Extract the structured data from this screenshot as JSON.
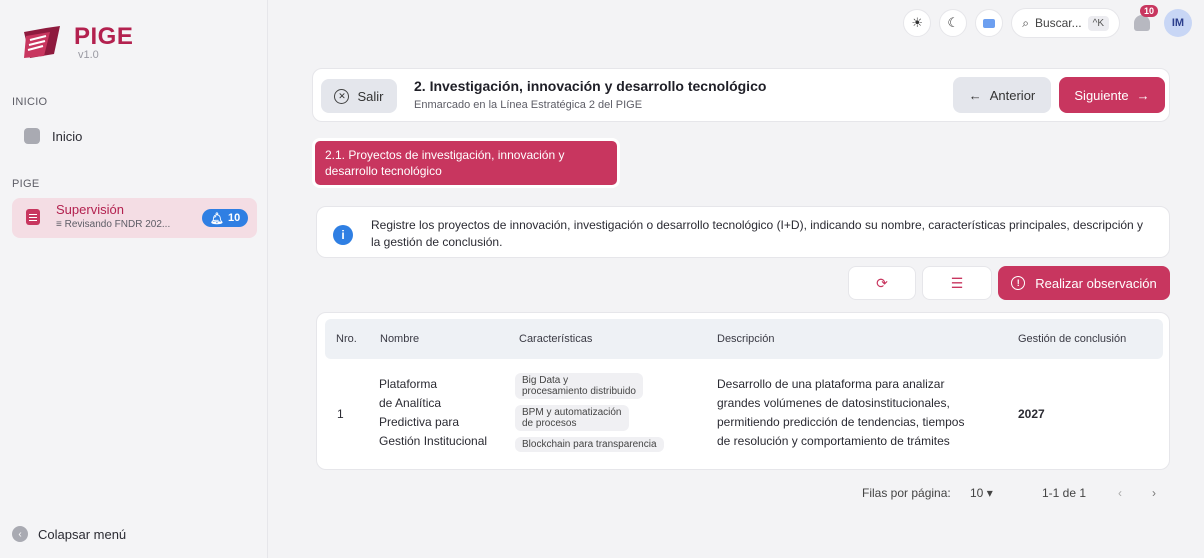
{
  "app": {
    "name": "PIGE",
    "version": "v1.0"
  },
  "sidebar": {
    "section_inicio": "INICIO",
    "home_label": "Inicio",
    "section_pige": "PIGE",
    "supervision": {
      "title": "Supervisión",
      "subtitle": "Revisando FNDR 202...",
      "badge": "10"
    },
    "collapse_label": "Colapsar menú"
  },
  "topbar": {
    "search_placeholder": "Buscar...",
    "search_shortcut": "^K",
    "notifications_count": "10",
    "avatar_initials": "IM"
  },
  "header": {
    "exit_label": "Salir",
    "title": "2. Investigación, innovación y desarrollo tecnológico",
    "subtitle": "Enmarcado en la Línea Estratégica 2 del PIGE",
    "prev_label": "Anterior",
    "next_label": "Siguiente"
  },
  "section_tag": "2.1. Proyectos de investigación, innovación y desarrollo tecnológico",
  "info_text": "Registre los proyectos de innovación, investigación o desarrollo tecnológico (I+D), indicando su nombre, características principales, descripción y la gestión de conclusión.",
  "actions": {
    "observation_label": "Realizar observación"
  },
  "table": {
    "headers": [
      "Nro.",
      "Nombre",
      "Características",
      "Descripción",
      "Gestión de conclusión"
    ],
    "rows": [
      {
        "nro": "1",
        "name_lines": [
          "Plataforma",
          "de Analítica",
          "Predictiva para",
          "Gestión Institucional"
        ],
        "chips": [
          [
            "Big Data y",
            "procesamiento distribuido"
          ],
          [
            "BPM y automatización",
            "de procesos"
          ],
          [
            "Blockchain para transparencia"
          ]
        ],
        "desc_lines": [
          "Desarrollo de una plataforma para analizar",
          "grandes volúmenes de datosinstitucionales,",
          "permitiendo predicción de tendencias, tiempos",
          "de resolución y comportamiento de trámites"
        ],
        "year": "2027"
      }
    ]
  },
  "pagination": {
    "rows_label": "Filas por página:",
    "rows_value": "10",
    "range": "1-1 de 1"
  },
  "colors": {
    "accent": "#c8365f",
    "info": "#2f7fe3"
  },
  "icons": [
    "search-icon",
    "sun-icon",
    "moon-icon",
    "monitor-icon",
    "bell-icon",
    "refresh-icon",
    "list-icon",
    "info-icon"
  ]
}
